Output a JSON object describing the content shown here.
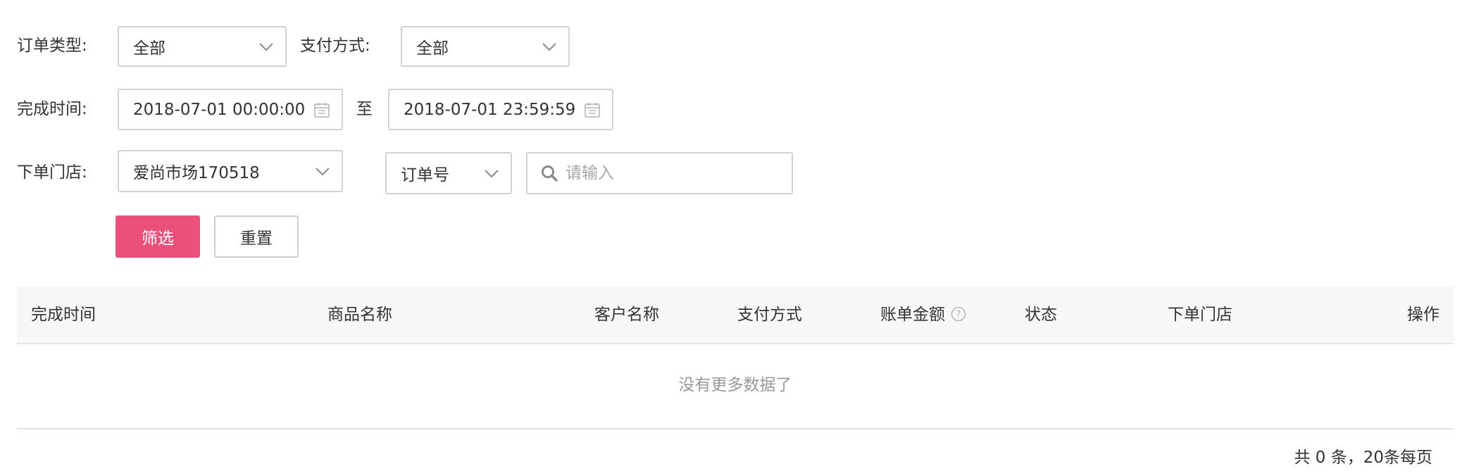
{
  "filters": {
    "order_type_label": "订单类型:",
    "order_type_value": "全部",
    "pay_method_label": "支付方式:",
    "pay_method_value": "全部",
    "finish_time_label": "完成时间:",
    "start_time": "2018-07-01 00:00:00",
    "range_separator": "至",
    "end_time": "2018-07-01 23:59:59",
    "store_label": "下单门店:",
    "store_value": "爱尚市场170518",
    "search_field_value": "订单号",
    "search_placeholder": "请输入"
  },
  "buttons": {
    "filter_label": "筛选",
    "reset_label": "重置"
  },
  "table": {
    "columns": [
      "完成时间",
      "商品名称",
      "客户名称",
      "支付方式",
      "账单金额",
      "状态",
      "下单门店",
      "操作"
    ],
    "empty_text": "没有更多数据了"
  },
  "pagination": {
    "summary": "共 0 条，20条每页"
  },
  "colors": {
    "primary": "#e9517a",
    "border": "#d2d2d2",
    "header_bg": "#f7f7f7",
    "muted_text": "#999999"
  },
  "icons": {
    "dropdown": "chevron-down-icon",
    "date": "calendar-icon",
    "search": "search-icon",
    "help": "help-circle-icon"
  }
}
